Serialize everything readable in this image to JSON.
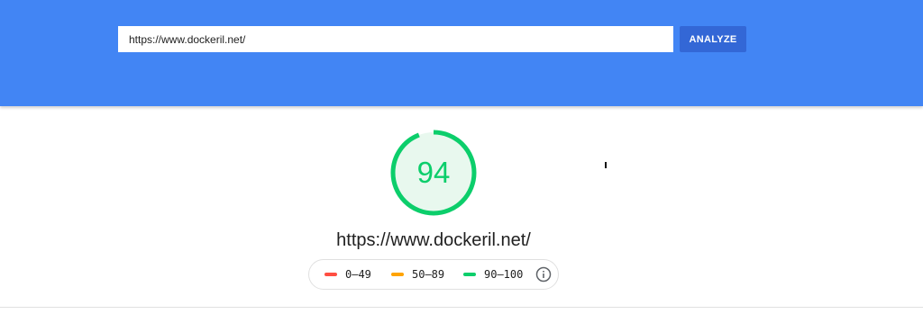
{
  "search": {
    "url_value": "https://www.dockeril.net/",
    "analyze_label": "ANALYZE"
  },
  "result": {
    "score": "94",
    "score_fraction": 0.94,
    "tested_url": "https://www.dockeril.net/"
  },
  "legend": {
    "items": [
      {
        "label": "0–49",
        "color": "#ff4e42"
      },
      {
        "label": "50–89",
        "color": "#ffa400"
      },
      {
        "label": "90–100",
        "color": "#0cce6b"
      }
    ],
    "info_icon": "info-icon"
  },
  "colors": {
    "header": "#4285f4",
    "button": "#3367d6",
    "score_pass": "#0cce6b",
    "gauge_fill": "#e8f8ee"
  }
}
